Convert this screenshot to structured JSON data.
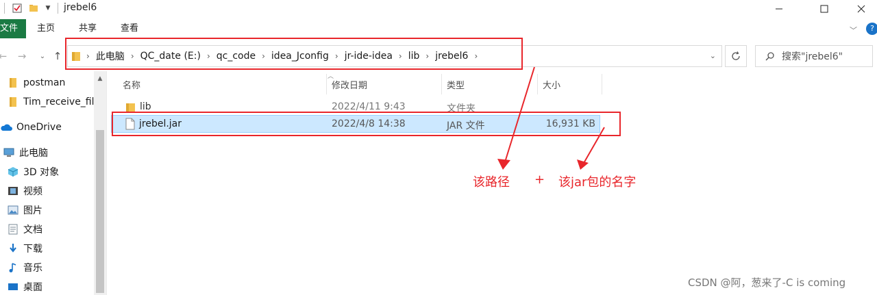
{
  "window": {
    "title": "jrebel6"
  },
  "ribbon": {
    "tabs": [
      "文件",
      "主页",
      "共享",
      "查看"
    ]
  },
  "address": {
    "breadcrumb": [
      "此电脑",
      "QC_date (E:)",
      "qc_code",
      "idea_Jconfig",
      "jr-ide-idea",
      "lib",
      "jrebel6"
    ]
  },
  "search": {
    "placeholder": "搜索\"jrebel6\""
  },
  "sidebar": {
    "items": [
      {
        "label": "postman",
        "icon": "folder-icon"
      },
      {
        "label": "Tim_receive_file",
        "icon": "folder-icon"
      },
      {
        "label": "OneDrive",
        "icon": "cloud-icon"
      },
      {
        "label": "此电脑",
        "icon": "computer-icon"
      },
      {
        "label": "3D 对象",
        "icon": "cube-icon"
      },
      {
        "label": "视频",
        "icon": "video-icon"
      },
      {
        "label": "图片",
        "icon": "picture-icon"
      },
      {
        "label": "文档",
        "icon": "document-icon"
      },
      {
        "label": "下载",
        "icon": "download-icon"
      },
      {
        "label": "音乐",
        "icon": "music-icon"
      },
      {
        "label": "桌面",
        "icon": "desktop-icon"
      }
    ]
  },
  "file_list": {
    "columns": [
      "名称",
      "修改日期",
      "类型",
      "大小"
    ],
    "rows": [
      {
        "name": "lib",
        "modified": "2022/4/11 9:43",
        "type": "文件夹",
        "size": "",
        "icon": "folder-icon",
        "selected": false
      },
      {
        "name": "jrebel.jar",
        "modified": "2022/4/8 14:38",
        "type": "JAR 文件",
        "size": "16,931 KB",
        "icon": "file-icon",
        "selected": true
      }
    ]
  },
  "annotations": {
    "path_label": "该路径",
    "plus": "+",
    "jar_label": "该jar包的名字",
    "color": "#e8262b"
  },
  "watermark": "CSDN @阿，葱来了-C is coming",
  "colors": {
    "file_tab": "#1a7a43",
    "selection": "#cce8ff",
    "folder": "#f3c24f"
  }
}
